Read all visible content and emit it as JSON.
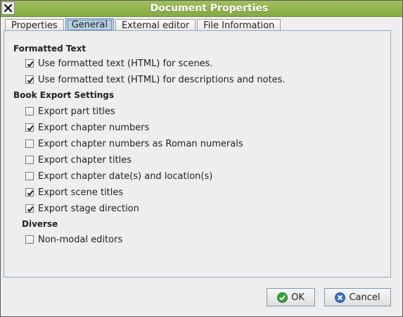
{
  "window": {
    "title": "Document Properties"
  },
  "tabs": [
    {
      "label": "Properties",
      "active": false
    },
    {
      "label": "General",
      "active": true
    },
    {
      "label": "External editor",
      "active": false
    },
    {
      "label": "File Information",
      "active": false
    }
  ],
  "sections": {
    "formatted_text": {
      "title": "Formatted Text",
      "options": [
        {
          "label": "Use formatted text (HTML) for scenes.",
          "checked": true
        },
        {
          "label": "Use formatted text (HTML) for descriptions and notes.",
          "checked": true
        }
      ]
    },
    "book_export": {
      "title": "Book Export Settings",
      "options": [
        {
          "label": "Export part titles",
          "checked": false
        },
        {
          "label": "Export chapter numbers",
          "checked": true
        },
        {
          "label": "Export chapter numbers as Roman numerals",
          "checked": false
        },
        {
          "label": "Export chapter titles",
          "checked": false
        },
        {
          "label": "Export chapter date(s) and location(s)",
          "checked": false
        },
        {
          "label": "Export scene titles",
          "checked": true
        },
        {
          "label": "Export stage direction",
          "checked": true
        }
      ]
    },
    "diverse": {
      "title": "Diverse",
      "options": [
        {
          "label": "Non-modal editors",
          "checked": false
        }
      ]
    }
  },
  "buttons": {
    "ok": "OK",
    "cancel": "Cancel"
  },
  "colors": {
    "titlebar": "#86aa42",
    "active_tab": "#b8cfe5",
    "ok_icon": "#3aa13a",
    "cancel_icon": "#3d6fc4"
  },
  "icons": {
    "close": "close-icon",
    "ok": "check-circle-icon",
    "cancel": "cancel-circle-icon"
  }
}
